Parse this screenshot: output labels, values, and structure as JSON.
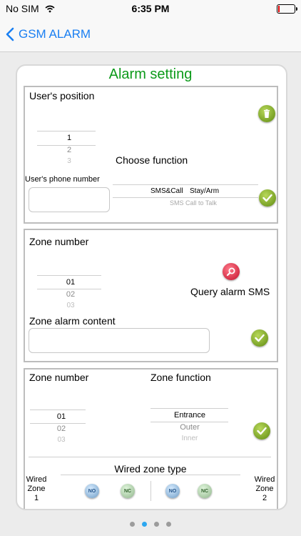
{
  "status_bar": {
    "carrier": "No SIM",
    "time": "6:35 PM"
  },
  "nav": {
    "back_label": "GSM ALARM"
  },
  "title": "Alarm setting",
  "section1": {
    "user_position_label": "User's position",
    "position_picker": [
      "1",
      "2",
      "3"
    ],
    "choose_function_label": "Choose function",
    "phone_label": "User's phone number",
    "phone_value": "",
    "function_options": [
      "SMS&Call",
      "Stay/Arm",
      "SMS Call to Talk"
    ]
  },
  "section2": {
    "zone_number_label": "Zone number",
    "zone_picker": [
      "01",
      "02",
      "03"
    ],
    "query_label": "Query alarm SMS",
    "alarm_content_label": "Zone alarm content",
    "alarm_content_value": ""
  },
  "section3": {
    "zone_number_label": "Zone number",
    "zone_function_label": "Zone function",
    "zone_picker": [
      "01",
      "02",
      "03"
    ],
    "function_picker": [
      "Entrance",
      "Outer",
      "Inner"
    ],
    "wired_type_label": "Wired zone type",
    "zone1_label": [
      "Wired",
      "Zone",
      "1"
    ],
    "zone2_label": [
      "Wired",
      "Zone",
      "2"
    ],
    "no_label": "NO",
    "nc_label": "NC"
  },
  "colors": {
    "accent": "#1a7ff2",
    "title_green": "#0c9a1a",
    "page_dot_active": "#2da7f0"
  },
  "pager": {
    "count": 4,
    "active": 1
  }
}
